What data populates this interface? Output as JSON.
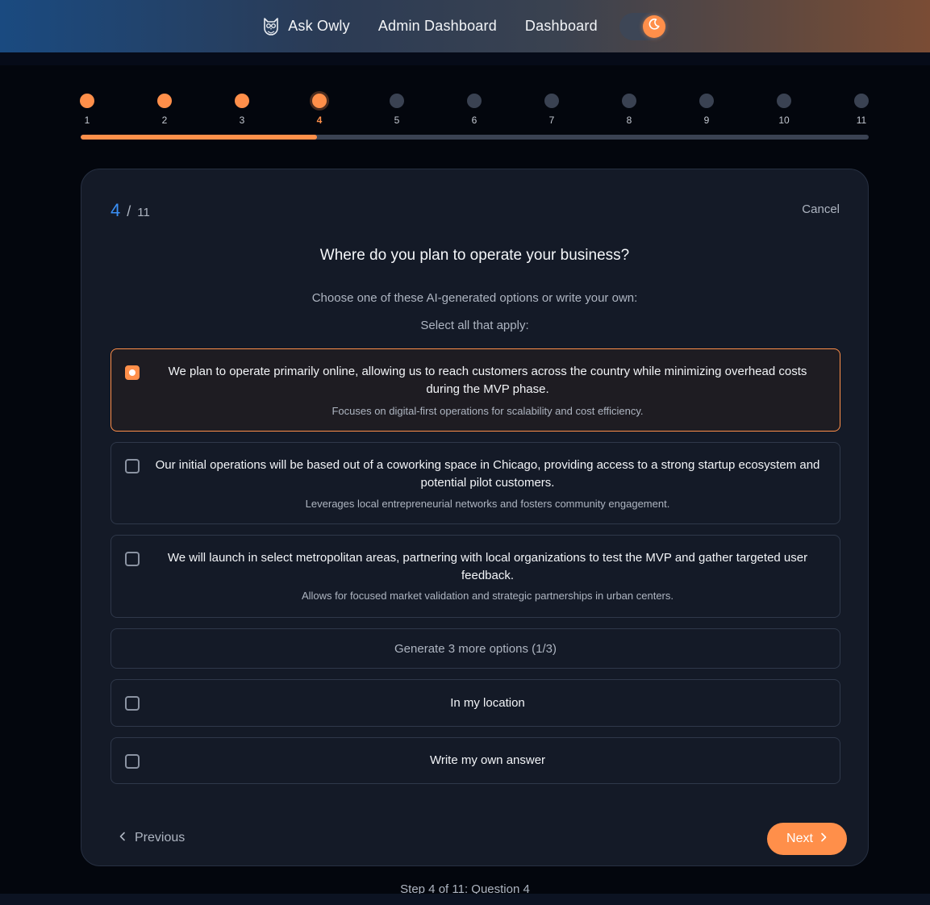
{
  "nav": {
    "brand": "Ask Owly",
    "links": [
      "Admin Dashboard",
      "Dashboard"
    ],
    "theme_toggle_icon": "moon-icon"
  },
  "stepper": {
    "steps": [
      "1",
      "2",
      "3",
      "4",
      "5",
      "6",
      "7",
      "8",
      "9",
      "10",
      "11"
    ],
    "current": 4,
    "progress": 0.3
  },
  "card": {
    "counter_current": "4",
    "counter_sep": "/",
    "counter_total": "11",
    "cancel_label": "Cancel",
    "question": "Where do you plan to operate your business?",
    "instruction": "Choose one of these AI-generated options or write your own:",
    "select_hint": "Select all that apply:",
    "options": [
      {
        "text": "We plan to operate primarily online, allowing us to reach customers across the country while minimizing overhead costs during the MVP phase.",
        "sub": "Focuses on digital-first operations for scalability and cost efficiency.",
        "selected": true
      },
      {
        "text": "Our initial operations will be based out of a coworking space in Chicago, providing access to a strong startup ecosystem and potential pilot customers.",
        "sub": "Leverages local entrepreneurial networks and fosters community engagement.",
        "selected": false
      },
      {
        "text": "We will launch in select metropolitan areas, partnering with local organizations to test the MVP and gather targeted user feedback.",
        "sub": "Allows for focused market validation and strategic partnerships in urban centers.",
        "selected": false
      }
    ],
    "generate_label": "Generate 3 more options (1/3)",
    "location_option": "In my location",
    "own_answer_option": "Write my own answer",
    "prev_label": "Previous",
    "next_label": "Next"
  },
  "footer": {
    "caption": "Step 4 of 11: Question 4"
  },
  "colors": {
    "accent": "#ff8f4a",
    "counter_blue": "#3a8ff5",
    "card_bg": "#141a27"
  }
}
